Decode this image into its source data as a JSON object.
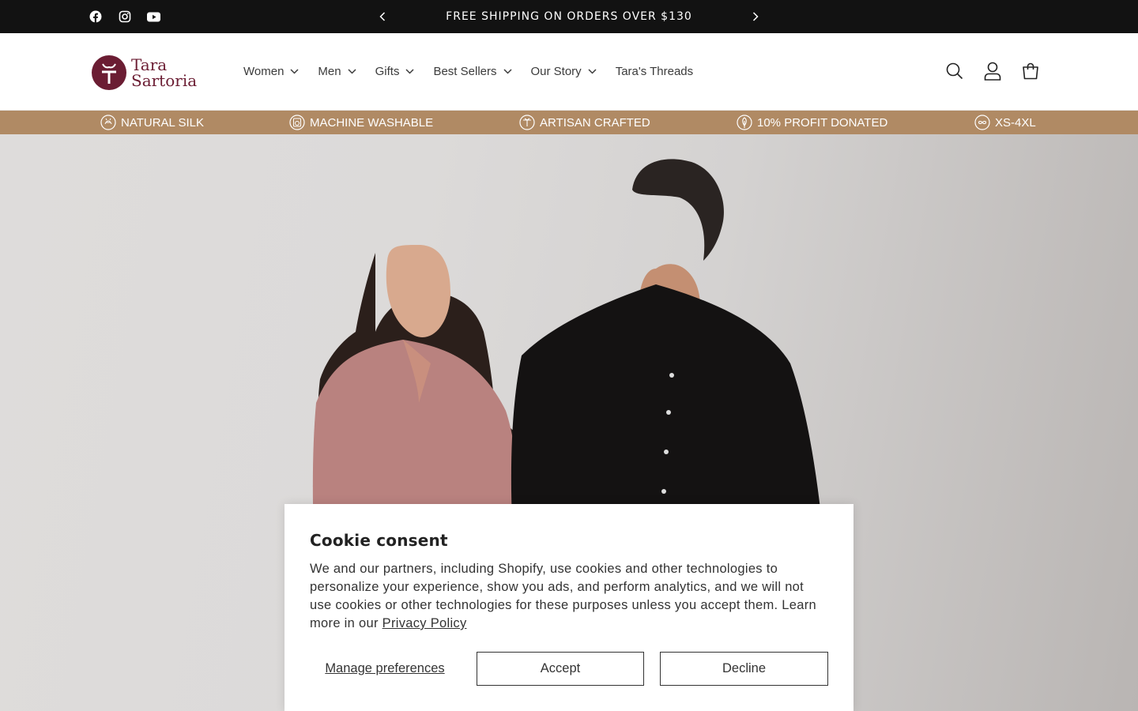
{
  "announcement": {
    "text": "FREE SHIPPING ON ORDERS OVER $130",
    "social": [
      "facebook-icon",
      "instagram-icon",
      "youtube-icon"
    ]
  },
  "header": {
    "logo_line1": "Tara",
    "logo_line2": "Sartoria",
    "nav": [
      {
        "label": "Women",
        "dropdown": true
      },
      {
        "label": "Men",
        "dropdown": true
      },
      {
        "label": "Gifts",
        "dropdown": true
      },
      {
        "label": "Best Sellers",
        "dropdown": true
      },
      {
        "label": "Our Story",
        "dropdown": true
      },
      {
        "label": "Tara's Threads",
        "dropdown": false
      }
    ],
    "icons": [
      "search-icon",
      "account-icon",
      "cart-icon"
    ]
  },
  "features": [
    {
      "label": "NATURAL SILK",
      "icon": "silkworm-icon"
    },
    {
      "label": "MACHINE WASHABLE",
      "icon": "washing-machine-icon"
    },
    {
      "label": "ARTISAN CRAFTED",
      "icon": "artisan-icon"
    },
    {
      "label": "10% PROFIT DONATED",
      "icon": "leaf-icon"
    },
    {
      "label": "XS-4XL",
      "icon": "infinity-icon"
    }
  ],
  "cookie": {
    "title": "Cookie consent",
    "message": "We and our partners, including Shopify, use cookies and other technologies to personalize your experience, show you ads, and perform analytics, and we will not use cookies or other technologies for these purposes unless you accept them. Learn more in our ",
    "privacy_link": "Privacy Policy",
    "manage_label": "Manage preferences",
    "accept_label": "Accept",
    "decline_label": "Decline"
  },
  "colors": {
    "announcement_bg": "#121212",
    "feature_strip_bg": "#b08a64",
    "brand": "#6b1d33"
  }
}
